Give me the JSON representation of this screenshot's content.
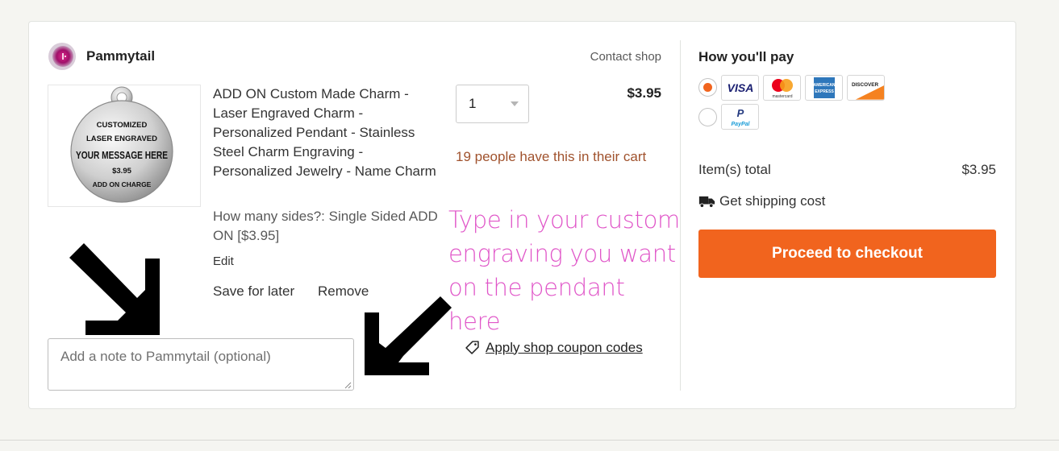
{
  "shop": {
    "name": "Pammytail",
    "contact_label": "Contact shop",
    "avatar_icon": "shop-avatar-icon"
  },
  "item": {
    "image": {
      "lines": [
        "CUSTOMIZED",
        "LASER ENGRAVED",
        "YOUR MESSAGE HERE",
        "$3.95",
        "ADD ON CHARGE"
      ]
    },
    "title": "ADD ON Custom Made Charm - Laser Engraved Charm - Personalized Pendant - Stainless Steel Charm Engraving - Personalized Jewelry - Name Charm",
    "variation": "How many sides?: Single Sided ADD ON [$3.95]",
    "edit_label": "Edit",
    "save_for_later_label": "Save for later",
    "remove_label": "Remove",
    "quantity": "1",
    "price": "$3.95",
    "cart_count_text": "19 people have this in their cart"
  },
  "annotation": {
    "text": "Type in your custom engraving you want on the pendant here",
    "color": "#e055c8"
  },
  "note": {
    "placeholder": "Add a note to Pammytail (optional)",
    "value": ""
  },
  "coupon": {
    "label": "Apply shop coupon codes",
    "icon": "tag-icon"
  },
  "payment": {
    "title": "How you'll pay",
    "options": [
      {
        "selected": true,
        "cards": [
          "VISA",
          "mastercard",
          "AMERICAN EXPRESS",
          "DISCOVER"
        ]
      },
      {
        "selected": false,
        "cards": [
          "PayPal"
        ]
      }
    ],
    "items_total_label": "Item(s) total",
    "items_total_value": "$3.95",
    "shipping_label": "Get shipping cost",
    "shipping_icon": "truck-icon",
    "checkout_label": "Proceed to checkout"
  },
  "colors": {
    "accent": "#f1641e",
    "cart_count": "#a0522d",
    "background": "#f5f5f1"
  }
}
